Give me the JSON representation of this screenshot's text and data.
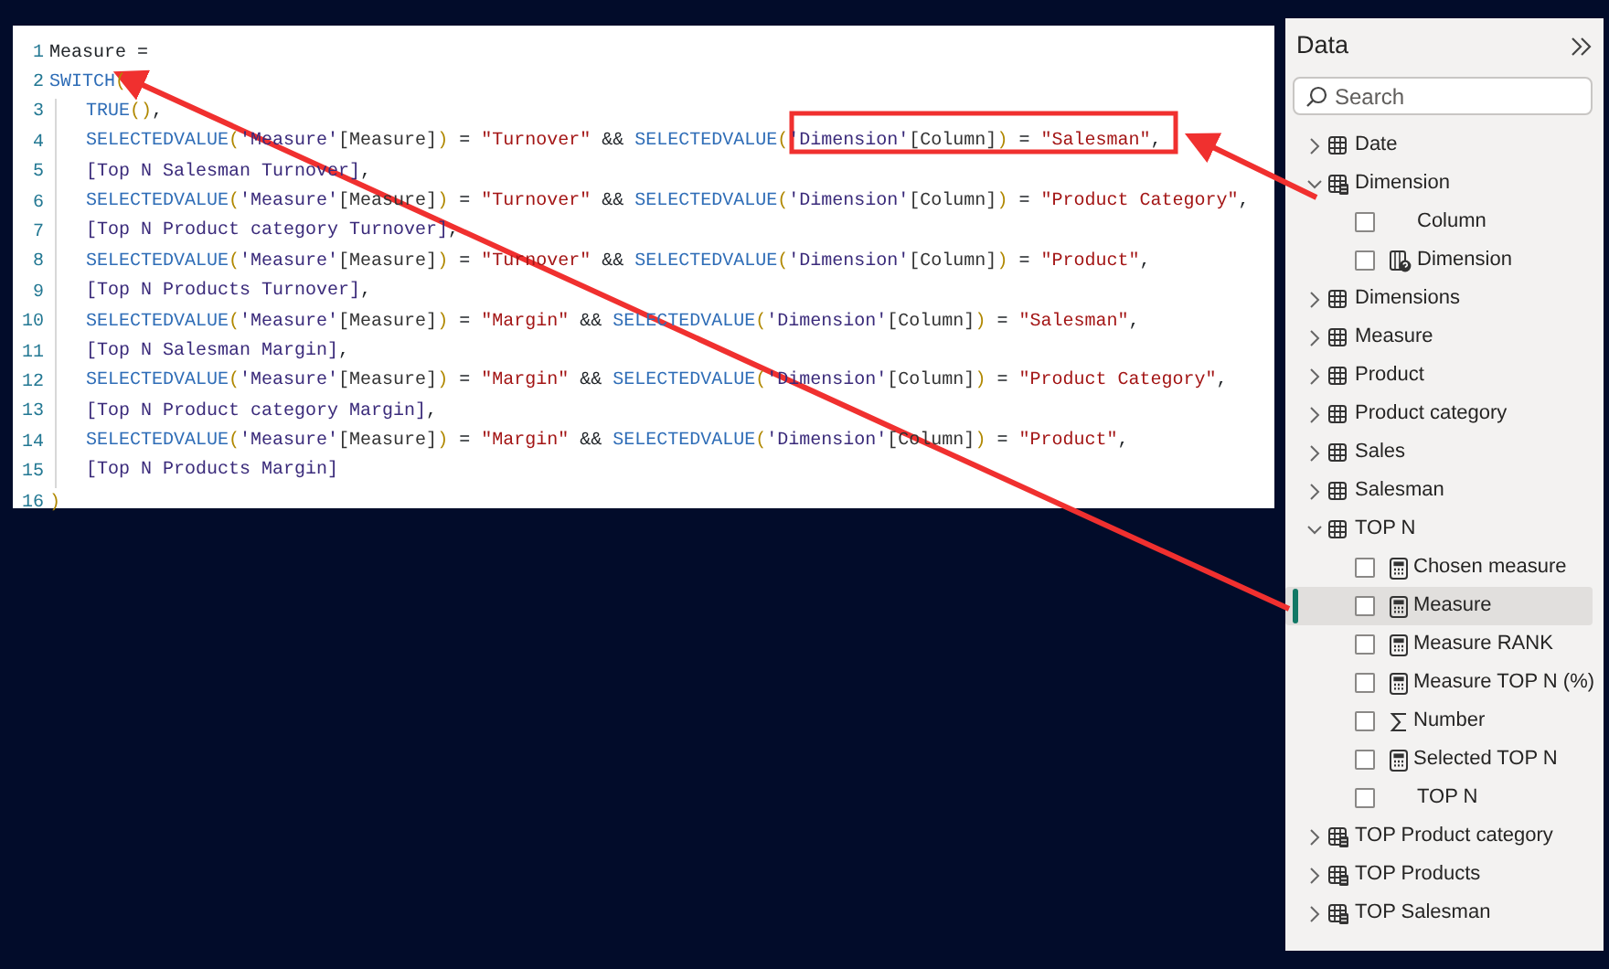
{
  "code_editor": {
    "lines": [
      {
        "number": "1",
        "text": "Measure =",
        "indented": false
      },
      {
        "number": "2",
        "text": "SWITCH(",
        "indented": false
      },
      {
        "number": "3",
        "text": "TRUE(),",
        "indented": true
      },
      {
        "number": "4",
        "text": "SELECTEDVALUE('Measure'[Measure]) = \"Turnover\" && SELECTEDVALUE('Dimension'[Column]) = \"Salesman\",",
        "indented": true
      },
      {
        "number": "5",
        "text": "[Top N Salesman Turnover],",
        "indented": true
      },
      {
        "number": "6",
        "text": "SELECTEDVALUE('Measure'[Measure]) = \"Turnover\" && SELECTEDVALUE('Dimension'[Column]) = \"Product Category\",",
        "indented": true
      },
      {
        "number": "7",
        "text": "[Top N Product category Turnover],",
        "indented": true
      },
      {
        "number": "8",
        "text": "SELECTEDVALUE('Measure'[Measure]) = \"Turnover\" && SELECTEDVALUE('Dimension'[Column]) = \"Product\",",
        "indented": true
      },
      {
        "number": "9",
        "text": "[Top N Products Turnover],",
        "indented": true
      },
      {
        "number": "10",
        "text": "SELECTEDVALUE('Measure'[Measure]) = \"Margin\" && SELECTEDVALUE('Dimension'[Column]) = \"Salesman\",",
        "indented": true
      },
      {
        "number": "11",
        "text": "[Top N Salesman Margin],",
        "indented": true
      },
      {
        "number": "12",
        "text": "SELECTEDVALUE('Measure'[Measure]) = \"Margin\" && SELECTEDVALUE('Dimension'[Column]) = \"Product Category\",",
        "indented": true
      },
      {
        "number": "13",
        "text": "[Top N Product category Margin],",
        "indented": true
      },
      {
        "number": "14",
        "text": "SELECTEDVALUE('Measure'[Measure]) = \"Margin\" && SELECTEDVALUE('Dimension'[Column]) = \"Product\",",
        "indented": true
      },
      {
        "number": "15",
        "text": "[Top N Products Margin]",
        "indented": true
      },
      {
        "number": "16",
        "text": ")",
        "indented": false
      }
    ]
  },
  "data_pane": {
    "title": "Data",
    "search": {
      "placeholder": "Search"
    },
    "tables": [
      {
        "name": "Date",
        "kind": "table",
        "expanded": false
      },
      {
        "name": "Dimension",
        "kind": "calc-table",
        "expanded": true,
        "children": [
          {
            "name": "Column",
            "kind": "plain",
            "checked": false,
            "selected": false
          },
          {
            "name": "Dimension",
            "kind": "param",
            "checked": false,
            "selected": false
          }
        ]
      },
      {
        "name": "Dimensions",
        "kind": "table",
        "expanded": false
      },
      {
        "name": "Measure",
        "kind": "table",
        "expanded": false
      },
      {
        "name": "Product",
        "kind": "table",
        "expanded": false
      },
      {
        "name": "Product category",
        "kind": "table",
        "expanded": false
      },
      {
        "name": "Sales",
        "kind": "table",
        "expanded": false
      },
      {
        "name": "Salesman",
        "kind": "table",
        "expanded": false
      },
      {
        "name": "TOP N",
        "kind": "table",
        "expanded": true,
        "children": [
          {
            "name": "Chosen measure",
            "kind": "measure",
            "checked": false,
            "selected": false
          },
          {
            "name": "Measure",
            "kind": "measure",
            "checked": false,
            "selected": true
          },
          {
            "name": "Measure RANK",
            "kind": "measure",
            "checked": false,
            "selected": false
          },
          {
            "name": "Measure TOP N (%)",
            "kind": "measure",
            "checked": false,
            "selected": false
          },
          {
            "name": "Number",
            "kind": "sum",
            "checked": false,
            "selected": false
          },
          {
            "name": "Selected TOP N",
            "kind": "measure",
            "checked": false,
            "selected": false
          },
          {
            "name": "TOP N",
            "kind": "plain",
            "checked": false,
            "selected": false
          }
        ]
      },
      {
        "name": "TOP Product category",
        "kind": "calc-table",
        "expanded": false
      },
      {
        "name": "TOP Products",
        "kind": "calc-table",
        "expanded": false
      },
      {
        "name": "TOP Salesman",
        "kind": "calc-table",
        "expanded": false
      }
    ]
  }
}
